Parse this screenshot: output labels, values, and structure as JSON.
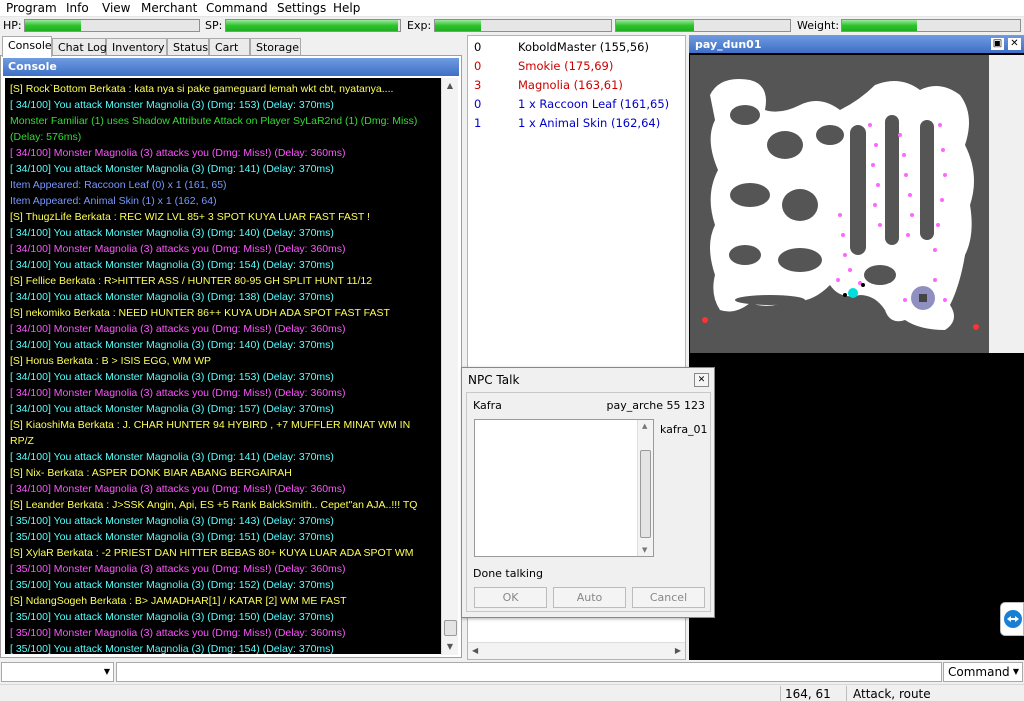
{
  "menu": [
    "Program",
    "Info",
    "View",
    "Merchant",
    "Command",
    "Settings",
    "Help"
  ],
  "stats": {
    "hp": {
      "label": "HP:",
      "fill": 0.32
    },
    "sp": {
      "label": "SP:",
      "fill": 0.99
    },
    "exp": {
      "label": "Exp:",
      "fill": 0.26,
      "fill2": 0.45
    },
    "weight": {
      "label": "Weight:",
      "fill": 0.42
    }
  },
  "tabs": [
    "Console",
    "Chat Log",
    "Inventory",
    "Status",
    "Cart",
    "Storage"
  ],
  "console": {
    "title": "Console",
    "lines": [
      {
        "text": "[S] Rock`Bottom Berkata : kata nya si pake gameguard lemah wkt cbt, nyatanya....",
        "color": "#ffff55"
      },
      {
        "text": "[ 34/100] You attack Monster Magnolia (3) (Dmg: 153) (Delay: 370ms)",
        "color": "#55ffff"
      },
      {
        "text": "Monster Familiar (1) uses Shadow Attribute Attack on Player SyLaR2nd (1) (Dmg: Miss) (Delay: 576ms)",
        "color": "#33dd33"
      },
      {
        "text": "[ 34/100] Monster Magnolia (3) attacks you (Dmg: Miss!) (Delay: 360ms)",
        "color": "#ff55ff"
      },
      {
        "text": "[ 34/100] You attack Monster Magnolia (3) (Dmg: 141) (Delay: 370ms)",
        "color": "#55ffff"
      },
      {
        "text": "Item Appeared: Raccoon Leaf (0) x 1 (161, 65)",
        "color": "#7799ff"
      },
      {
        "text": "Item Appeared: Animal Skin (1) x 1 (162, 64)",
        "color": "#7799ff"
      },
      {
        "text": "[S] ThugzLife Berkata : REC WIZ LVL 85+ 3 SPOT KUYA LUAR FAST FAST !",
        "color": "#ffff55"
      },
      {
        "text": "[ 34/100] You attack Monster Magnolia (3) (Dmg: 140) (Delay: 370ms)",
        "color": "#55ffff"
      },
      {
        "text": "[ 34/100] Monster Magnolia (3) attacks you (Dmg: Miss!) (Delay: 360ms)",
        "color": "#ff55ff"
      },
      {
        "text": "[ 34/100] You attack Monster Magnolia (3) (Dmg: 154) (Delay: 370ms)",
        "color": "#55ffff"
      },
      {
        "text": "[S] Fellice Berkata : R>HITTER ASS / HUNTER 80-95 GH SPLIT HUNT 11/12",
        "color": "#ffff55"
      },
      {
        "text": "[ 34/100] You attack Monster Magnolia (3) (Dmg: 138) (Delay: 370ms)",
        "color": "#55ffff"
      },
      {
        "text": "[S] nekomiko Berkata : NEED HUNTER 86++ KUYA UDH ADA SPOT FAST FAST",
        "color": "#ffff55"
      },
      {
        "text": "[ 34/100] Monster Magnolia (3) attacks you (Dmg: Miss!) (Delay: 360ms)",
        "color": "#ff55ff"
      },
      {
        "text": "[ 34/100] You attack Monster Magnolia (3) (Dmg: 140) (Delay: 370ms)",
        "color": "#55ffff"
      },
      {
        "text": "[S] Horus Berkata : B > ISIS EGG, WM WP",
        "color": "#ffff55"
      },
      {
        "text": "[ 34/100] You attack Monster Magnolia (3) (Dmg: 153) (Delay: 370ms)",
        "color": "#55ffff"
      },
      {
        "text": "[ 34/100] Monster Magnolia (3) attacks you (Dmg: Miss!) (Delay: 360ms)",
        "color": "#ff55ff"
      },
      {
        "text": "[ 34/100] You attack Monster Magnolia (3) (Dmg: 157) (Delay: 370ms)",
        "color": "#55ffff"
      },
      {
        "text": "[S] KiaoshiMa Berkata : J. CHAR HUNTER 94 HYBIRD , +7 MUFFLER MINAT WM IN RP/Z",
        "color": "#ffff55"
      },
      {
        "text": "[ 34/100] You attack Monster Magnolia (3) (Dmg: 141) (Delay: 370ms)",
        "color": "#55ffff"
      },
      {
        "text": "[S] Nix- Berkata : ASPER DONK BIAR ABANG BERGAIRAH",
        "color": "#ffff55"
      },
      {
        "text": "[ 34/100] Monster Magnolia (3) attacks you (Dmg: Miss!) (Delay: 360ms)",
        "color": "#ff55ff"
      },
      {
        "text": "[S] Leander Berkata : J>SSK Angin, Api, ES +5 Rank BalckSmith.. Cepet\"an AJA..!!! TQ",
        "color": "#ffff55"
      },
      {
        "text": "[ 35/100] You attack Monster Magnolia (3) (Dmg: 143) (Delay: 370ms)",
        "color": "#55ffff"
      },
      {
        "text": "[ 35/100] You attack Monster Magnolia (3) (Dmg: 151) (Delay: 370ms)",
        "color": "#55ffff"
      },
      {
        "text": "[S] XylaR Berkata : -2 PRIEST DAN HITTER BEBAS 80+ KUYA LUAR ADA SPOT WM",
        "color": "#ffff55"
      },
      {
        "text": "[ 35/100] Monster Magnolia (3) attacks you (Dmg: Miss!) (Delay: 360ms)",
        "color": "#ff55ff"
      },
      {
        "text": "[ 35/100] You attack Monster Magnolia (3) (Dmg: 152) (Delay: 370ms)",
        "color": "#55ffff"
      },
      {
        "text": "[S] NdangSogeh Berkata : B> JAMADHAR[1] / KATAR [2] WM ME FAST",
        "color": "#ffff55"
      },
      {
        "text": "[ 35/100] You attack Monster Magnolia (3) (Dmg: 150) (Delay: 370ms)",
        "color": "#55ffff"
      },
      {
        "text": "[ 35/100] Monster Magnolia (3) attacks you (Dmg: Miss!) (Delay: 360ms)",
        "color": "#ff55ff"
      },
      {
        "text": "[ 35/100] You attack Monster Magnolia (3) (Dmg: 154) (Delay: 370ms)",
        "color": "#55ffff"
      }
    ]
  },
  "entities": [
    {
      "num": "0",
      "name": "KoboldMaster (155,56)",
      "color": "#000000"
    },
    {
      "num": "0",
      "name": "Smokie (175,69)",
      "color": "#cc0000"
    },
    {
      "num": "3",
      "name": "Magnolia (163,61)",
      "color": "#cc0000"
    },
    {
      "num": "0",
      "name": "1 x Raccoon Leaf (161,65)",
      "color": "#0000cc"
    },
    {
      "num": "1",
      "name": "1 x Animal Skin (162,64)",
      "color": "#0000cc"
    }
  ],
  "map": {
    "title": "pay_dun01",
    "min_icon": "minimize-icon",
    "close_icon": "close-icon"
  },
  "npc": {
    "title": "NPC Talk",
    "name": "Kafra",
    "location": "pay_arche 55 123",
    "npc_id": "kafra_01",
    "status": "Done talking",
    "buttons": {
      "ok": "OK",
      "auto": "Auto",
      "cancel": "Cancel"
    }
  },
  "command": {
    "input_value": "",
    "select_value": "Command"
  },
  "statusbar": {
    "coords": "164, 61",
    "mode": "Attack, route"
  }
}
